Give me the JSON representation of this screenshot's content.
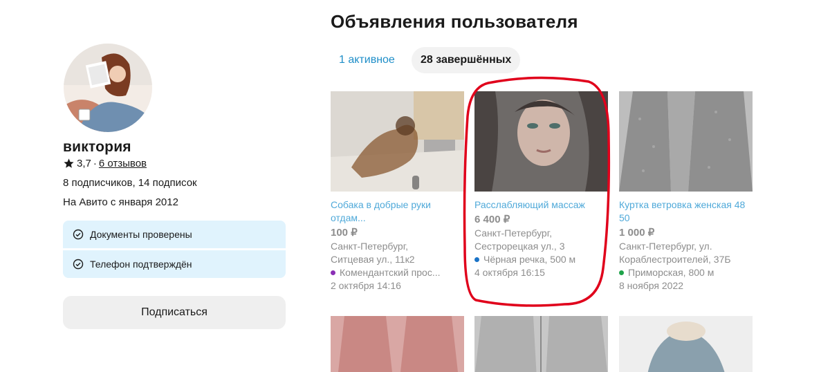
{
  "profile": {
    "name": "виктория",
    "rating": "3,7",
    "rating_sep": "·",
    "reviews_link": "6 отзывов",
    "followers": "8 подписчиков, 14 подписок",
    "since": "На Авито с января 2012",
    "verifications": [
      "Документы проверены",
      "Телефон подтверждён"
    ],
    "subscribe_label": "Подписаться"
  },
  "listings": {
    "title": "Объявления пользователя",
    "tabs": [
      {
        "label": "1 активное",
        "active": false
      },
      {
        "label": "28 завершённых",
        "active": true
      }
    ],
    "cards": [
      {
        "title": "Собака в добрые руки отдам...",
        "price": "100 ₽",
        "addr1": "Санкт-Петербург,",
        "addr2": "Ситцевая ул., 11к2",
        "metro": "Комендантский прос...",
        "metro_color": "#8b2fb5",
        "date": "2 октября 14:16"
      },
      {
        "title": "Расслабляющий массаж",
        "price": "6 400 ₽",
        "addr1": "Санкт-Петербург,",
        "addr2": "Сестрорецкая ул., 3",
        "metro": "Чёрная речка, 500 м",
        "metro_color": "#1a73c7",
        "date": "4 октября 16:15"
      },
      {
        "title": "Куртка ветровка женская 48 50",
        "price": "1 000 ₽",
        "addr1": "Санкт-Петербург, ул.",
        "addr2": "Кораблестроителей, 37Б",
        "metro": "Приморская, 800 м",
        "metro_color": "#1fa34a",
        "date": "8 ноября 2022"
      }
    ]
  },
  "colors": {
    "link": "#1e8ec8",
    "verify_bg": "#e0f3fd",
    "highlight": "#e0001b"
  }
}
